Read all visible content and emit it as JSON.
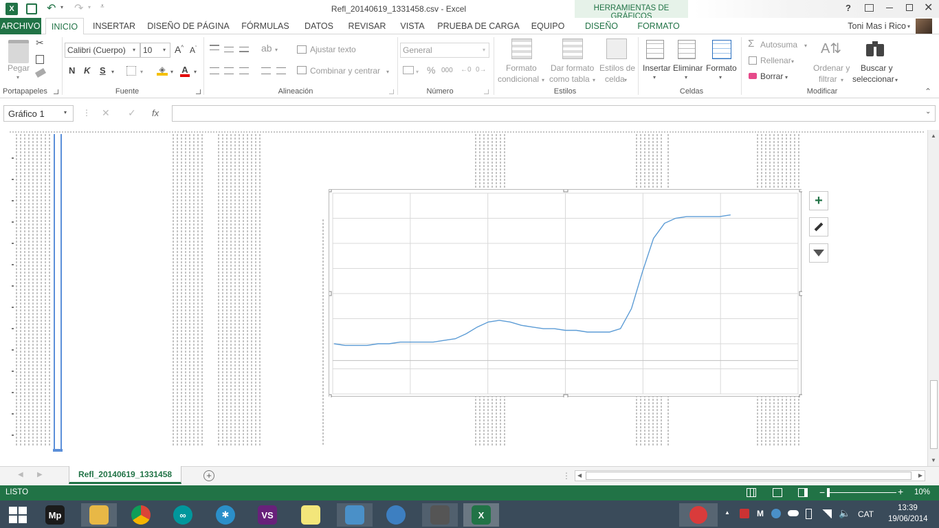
{
  "window": {
    "title": "Refl_20140619_1331458.csv - Excel",
    "context_title": "HERRAMIENTAS DE GRÁFICOS",
    "user": "Toni Mas i Rico",
    "help": "?"
  },
  "tabs": {
    "archivo": "ARCHIVO",
    "inicio": "INICIO",
    "insertar": "INSERTAR",
    "diseno_pagina": "DISEÑO DE PÁGINA",
    "formulas": "FÓRMULAS",
    "datos": "DATOS",
    "revisar": "REVISAR",
    "vista": "VISTA",
    "prueba": "PRUEBA DE CARGA",
    "equipo": "EQUIPO",
    "diseno": "DISEÑO",
    "formato": "FORMATO"
  },
  "ribbon": {
    "portapapeles": {
      "label": "Portapapeles",
      "pegar": "Pegar"
    },
    "fuente": {
      "label": "Fuente",
      "font_name": "Calibri (Cuerpo)",
      "font_size": "10",
      "bold": "N",
      "italic": "K",
      "underline": "S"
    },
    "alineacion": {
      "label": "Alineación",
      "ajustar": "Ajustar texto",
      "combinar": "Combinar y centrar"
    },
    "numero": {
      "label": "Número",
      "format": "General",
      "percent": "%",
      "thousands": "000"
    },
    "estilos": {
      "label": "Estilos",
      "formato_cond_1": "Formato",
      "formato_cond_2": "condicional",
      "dar_formato_1": "Dar formato",
      "dar_formato_2": "como tabla",
      "estilos_celda_1": "Estilos de",
      "estilos_celda_2": "celda"
    },
    "celdas": {
      "label": "Celdas",
      "insertar": "Insertar",
      "eliminar": "Eliminar",
      "formato": "Formato"
    },
    "modificar": {
      "label": "Modificar",
      "autosuma": "Autosuma",
      "rellenar": "Rellenar",
      "borrar": "Borrar",
      "ordenar_1": "Ordenar y",
      "ordenar_2": "filtrar",
      "buscar_1": "Buscar y",
      "buscar_2": "seleccionar"
    }
  },
  "formula_bar": {
    "name_box": "Gráfico 1",
    "fx": "fx",
    "value": ""
  },
  "sheet_tab": {
    "name": "Refl_20140619_1331458"
  },
  "status": {
    "ready": "LISTO",
    "zoom": "10%"
  },
  "taskbar": {
    "time": "13:39",
    "date": "19/06/2014",
    "lang": "CAT"
  },
  "colors": {
    "excel_green": "#217346",
    "series": "#5b9bd5",
    "accent": "#217346"
  },
  "chart_data": {
    "type": "line",
    "title": "",
    "xlabel": "",
    "ylabel": "",
    "grid": true,
    "legend": "none",
    "series": [
      {
        "color": "#5b9bd5",
        "values": [
          0.1,
          0.09,
          0.09,
          0.09,
          0.1,
          0.1,
          0.11,
          0.11,
          0.11,
          0.11,
          0.12,
          0.13,
          0.16,
          0.2,
          0.23,
          0.24,
          0.23,
          0.21,
          0.2,
          0.19,
          0.19,
          0.18,
          0.18,
          0.17,
          0.17,
          0.17,
          0.19,
          0.31,
          0.53,
          0.73,
          0.82,
          0.85,
          0.86,
          0.86,
          0.86,
          0.86,
          0.87
        ]
      }
    ]
  }
}
